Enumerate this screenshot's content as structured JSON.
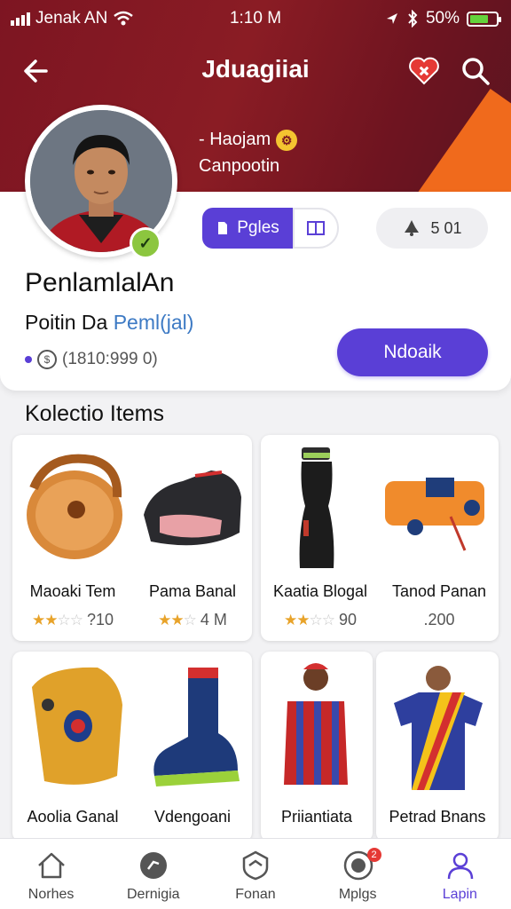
{
  "status_bar": {
    "carrier": "Jenak AN",
    "time": "1:10 M",
    "battery": "50%"
  },
  "header": {
    "title": "Jduagiiai"
  },
  "team": {
    "line1": "- Haojam",
    "line2": "Canpootin"
  },
  "profile": {
    "name": "PenlamlalAn",
    "subtitle_prefix": "Poitin Da",
    "subtitle_accent": "Peml(jal)",
    "followers": "(1810:999 0)",
    "segment_active": "Pgles",
    "stat_value": "5 01",
    "action_label": "Ndoaik"
  },
  "collection": {
    "title": "Kolectio Items",
    "items": [
      {
        "name": "Maoaki Tem",
        "meta": "?10",
        "rating": 2
      },
      {
        "name": "Pama Banal",
        "meta": "4 M",
        "rating": 2
      },
      {
        "name": "Kaatia Blogal",
        "meta": "90",
        "rating": 2
      },
      {
        "name": "Tanod Panan",
        "meta": ".200",
        "rating": 0
      },
      {
        "name": "Aoolia Ganal",
        "meta": "",
        "rating": 0
      },
      {
        "name": "Vdengoani",
        "meta": "",
        "rating": 0
      },
      {
        "name": "Priiantiata",
        "meta": "",
        "rating": 0
      },
      {
        "name": "Petrad Bnans",
        "meta": "",
        "rating": 0
      }
    ]
  },
  "tabbar": {
    "tabs": [
      {
        "label": "Norhes",
        "icon": "home-icon"
      },
      {
        "label": "Dernigia",
        "icon": "ball-icon"
      },
      {
        "label": "Fonan",
        "icon": "shield-icon"
      },
      {
        "label": "Mplgs",
        "icon": "chat-icon",
        "badge": "2"
      },
      {
        "label": "Lapin",
        "icon": "person-icon"
      }
    ]
  },
  "colors": {
    "header": "#8a1c24",
    "accent": "#5a3fd6",
    "orange": "#f06a1c"
  }
}
